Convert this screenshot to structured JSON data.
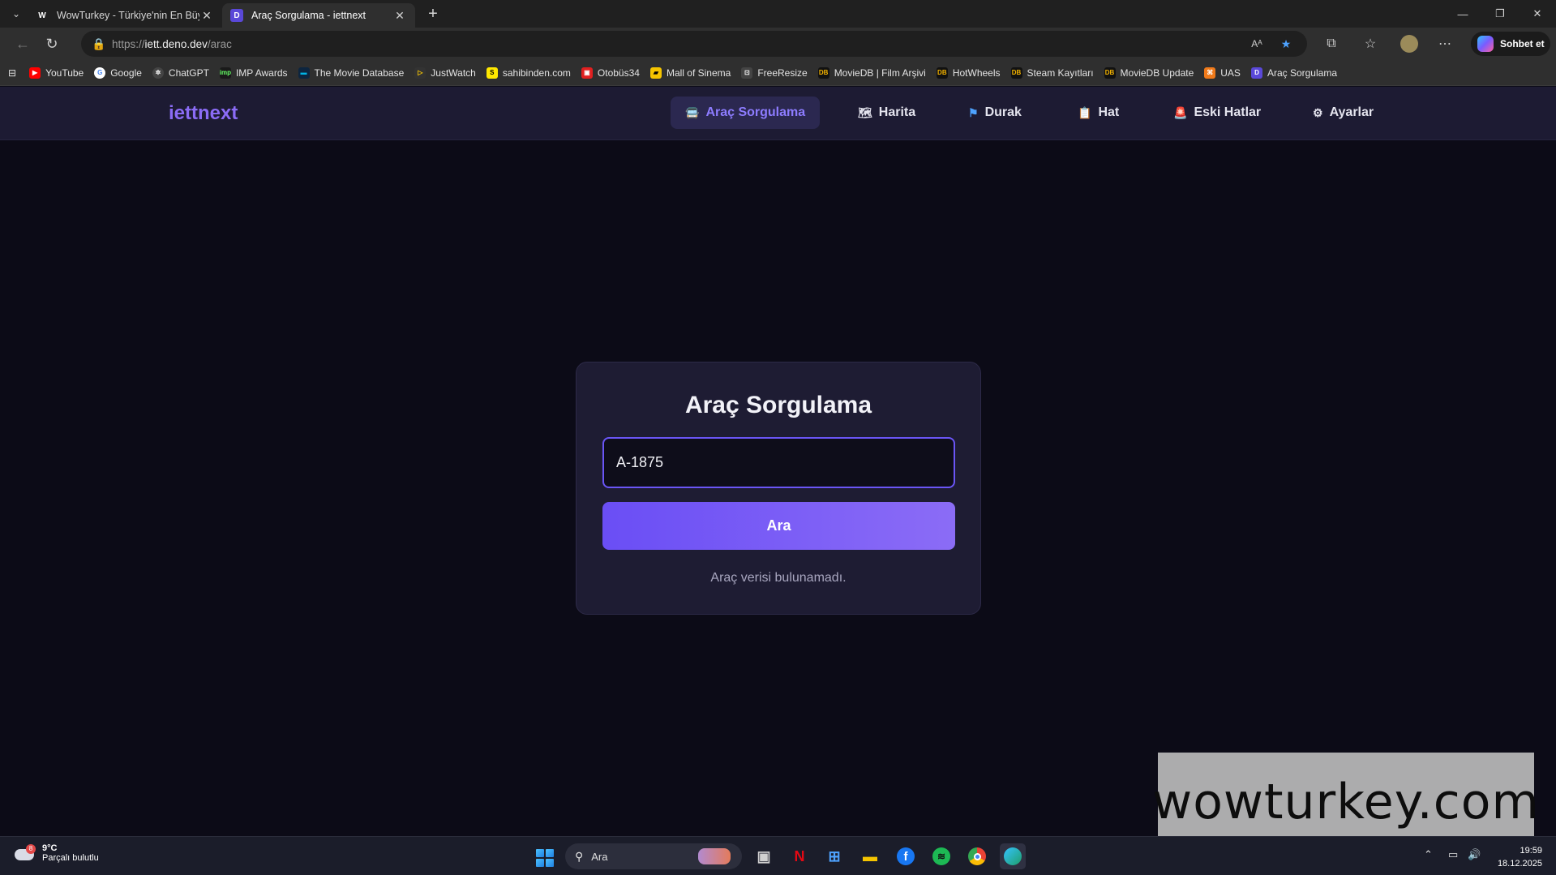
{
  "browser": {
    "tabs": [
      {
        "title": "WowTurkey - Türkiye'nin En Büyük",
        "favicon": "W",
        "active": false
      },
      {
        "title": "Araç Sorgulama - iettnext",
        "favicon": "D",
        "active": true
      }
    ],
    "url": {
      "scheme": "https://",
      "host": "iett.deno.dev",
      "path": "/arac"
    },
    "copilot_label": "Sohbet et",
    "bookmarks": [
      {
        "label": "YouTube",
        "icon": "youtube-icon",
        "color": "#ff0000"
      },
      {
        "label": "Google",
        "icon": "google-icon",
        "color": "#ffffff"
      },
      {
        "label": "ChatGPT",
        "icon": "chatgpt-icon",
        "color": "#444444"
      },
      {
        "label": "IMP Awards",
        "icon": "impawards-icon",
        "color": "#1a1a1a"
      },
      {
        "label": "The Movie Database",
        "icon": "tmdb-icon",
        "color": "#0d253f"
      },
      {
        "label": "JustWatch",
        "icon": "justwatch-icon",
        "color": "#333333"
      },
      {
        "label": "sahibinden.com",
        "icon": "sahibinden-icon",
        "color": "#ffe800"
      },
      {
        "label": "Otobüs34",
        "icon": "otobus34-icon",
        "color": "#e02020"
      },
      {
        "label": "Mall of Sinema",
        "icon": "mallofsinema-icon",
        "color": "#f5c400"
      },
      {
        "label": "FreeResize",
        "icon": "freeresize-icon",
        "color": "#444444"
      },
      {
        "label": "MovieDB | Film Arşivi",
        "icon": "moviedb-icon",
        "color": "#111111"
      },
      {
        "label": "HotWheels",
        "icon": "moviedb-icon",
        "color": "#111111"
      },
      {
        "label": "Steam Kayıtları",
        "icon": "moviedb-icon",
        "color": "#111111"
      },
      {
        "label": "MovieDB Update",
        "icon": "moviedb-icon",
        "color": "#111111"
      },
      {
        "label": "UAS",
        "icon": "uas-icon",
        "color": "#f07a1a"
      },
      {
        "label": "Araç Sorgulama",
        "icon": "deno-icon",
        "color": "#5a48d8"
      }
    ]
  },
  "site": {
    "brand": "iettnext",
    "nav": [
      {
        "label": "Araç Sorgulama",
        "icon": "bus-icon",
        "glyph": "🚍",
        "active": true
      },
      {
        "label": "Harita",
        "icon": "map-icon",
        "glyph": "🗺",
        "active": false
      },
      {
        "label": "Durak",
        "icon": "flag-icon",
        "glyph": "⚑",
        "active": false
      },
      {
        "label": "Hat",
        "icon": "clipboard-icon",
        "glyph": "📋",
        "active": false
      },
      {
        "label": "Eski Hatlar",
        "icon": "siren-icon",
        "glyph": "🚨",
        "active": false
      },
      {
        "label": "Ayarlar",
        "icon": "gear-icon",
        "glyph": "⚙",
        "active": false
      }
    ],
    "accent_color": "#8b6cf6"
  },
  "query_card": {
    "title": "Araç Sorgulama",
    "input_value": "A-1875",
    "button_label": "Ara",
    "status": "Araç verisi bulunamadı."
  },
  "watermark": "wowturkey.com",
  "taskbar": {
    "weather_temp": "9°C",
    "weather_desc": "Parçalı bulutlu",
    "weather_badge": "8",
    "search_placeholder": "Ara",
    "time": "19:59",
    "date": "18.12.2025"
  }
}
